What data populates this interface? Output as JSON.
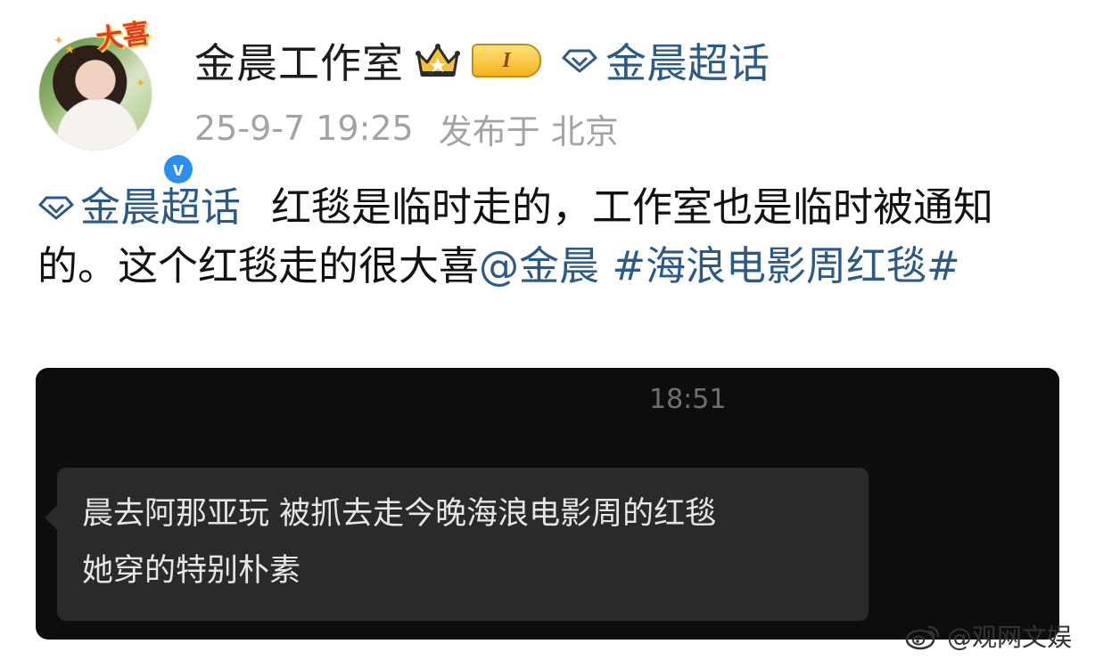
{
  "header": {
    "avatar_badge": "大喜",
    "username": "金晨工作室",
    "level_badge": "I",
    "topic_link": "金晨超话",
    "timestamp": "25-9-7 19:25",
    "location": "发布于 北京"
  },
  "post": {
    "topic_tag": "金晨超话",
    "text_part1": "红毯是临时走的，工作室也是临时被通知的。这个红毯走的很大喜",
    "mention": "@金晨",
    "hashtag": "#海浪电影周红毯#"
  },
  "screenshot": {
    "time": "18:51",
    "message_line1": "晨去阿那亚玩  被抓去走今晚海浪电影周的红毯",
    "message_line2": "她穿的特别朴素"
  },
  "watermark": {
    "text": "@观网文娱"
  },
  "colors": {
    "link_blue": "#2c5a86",
    "meta_gray": "#a3a3a3",
    "verified_blue": "#2b8ff0",
    "screenshot_bg": "#0d0d0d",
    "bubble_bg": "#2a2a2a"
  },
  "icons": [
    "avatar",
    "verified-icon",
    "crown-icon",
    "diamond-icon",
    "weibo-icon"
  ]
}
